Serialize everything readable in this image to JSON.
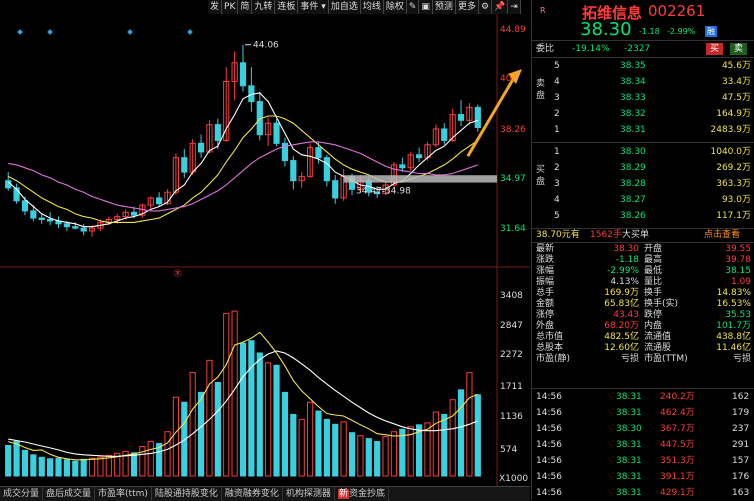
{
  "toolbar": [
    "发",
    "PK",
    "简",
    "九转",
    "连板",
    "事件",
    "加自选",
    "均线",
    "除权",
    "",
    "",
    "预测",
    "更多"
  ],
  "header": {
    "flag": "R",
    "name": "拓维信息",
    "code": "002261",
    "price": "38.30",
    "change": "-1.18",
    "change_pct": "-2.99%",
    "badge": "融"
  },
  "weibi": {
    "label": "委比",
    "pct": "-19.14%",
    "diff": "-2327",
    "buy_btn": "买",
    "sell_btn": "卖"
  },
  "sell_side_label": "卖盘",
  "buy_side_label": "买盘",
  "sell_orders": [
    {
      "level": "5",
      "price": "38.35",
      "volume": "45.6万"
    },
    {
      "level": "4",
      "price": "38.34",
      "volume": "33.4万"
    },
    {
      "level": "3",
      "price": "38.33",
      "volume": "47.5万"
    },
    {
      "level": "2",
      "price": "38.32",
      "volume": "164.9万"
    },
    {
      "level": "1",
      "price": "38.31",
      "volume": "2483.9万"
    }
  ],
  "buy_orders": [
    {
      "level": "1",
      "price": "38.30",
      "volume": "1040.0万"
    },
    {
      "level": "2",
      "price": "38.29",
      "volume": "269.2万"
    },
    {
      "level": "3",
      "price": "38.28",
      "volume": "363.3万"
    },
    {
      "level": "4",
      "price": "38.27",
      "volume": "93.0万"
    },
    {
      "level": "5",
      "price": "38.26",
      "volume": "117.1万"
    }
  ],
  "big_order": {
    "price": "38.70元有",
    "qty": "1562手",
    "type": "大买单",
    "link": "点击查看"
  },
  "stats": [
    {
      "l1": "最新",
      "v1": "38.30",
      "c1": "red",
      "l2": "开盘",
      "v2": "39.55",
      "c2": "red"
    },
    {
      "l1": "涨跌",
      "v1": "-1.18",
      "c1": "green",
      "l2": "最高",
      "v2": "39.78",
      "c2": "red"
    },
    {
      "l1": "涨幅",
      "v1": "-2.99%",
      "c1": "green",
      "l2": "最低",
      "v2": "38.15",
      "c2": "green"
    },
    {
      "l1": "振幅",
      "v1": "4.13%",
      "c1": "white",
      "l2": "量比",
      "v2": "1.09",
      "c2": "red"
    },
    {
      "l1": "总手",
      "v1": "169.9万",
      "c1": "yellow",
      "l2": "换手",
      "v2": "14.83%",
      "c2": "yellow"
    },
    {
      "l1": "金额",
      "v1": "65.83亿",
      "c1": "yellow",
      "l2": "换手(实)",
      "v2": "16.53%",
      "c2": "yellow"
    },
    {
      "l1": "涨停",
      "v1": "43.43",
      "c1": "red",
      "l2": "跌停",
      "v2": "35.53",
      "c2": "green"
    },
    {
      "l1": "外盘",
      "v1": "68.20万",
      "c1": "red",
      "l2": "内盘",
      "v2": "101.7万",
      "c2": "green"
    },
    {
      "l1": "总市值",
      "v1": "482.5亿",
      "c1": "yellow",
      "l2": "流通值",
      "v2": "438.8亿",
      "c2": "yellow"
    },
    {
      "l1": "总股本",
      "v1": "12.60亿",
      "c1": "yellow",
      "l2": "流通股",
      "v2": "11.46亿",
      "c2": "yellow"
    },
    {
      "l1": "市盈(静)",
      "v1": "亏损",
      "c1": "white",
      "l2": "市盈(TTM)",
      "v2": "亏损",
      "c2": "white"
    }
  ],
  "trades": [
    {
      "time": "14:56",
      "price": "38.31",
      "vol": "240.2万",
      "extra": "162"
    },
    {
      "time": "14:56",
      "price": "38.31",
      "vol": "462.4万",
      "extra": "179"
    },
    {
      "time": "14:56",
      "price": "38.30",
      "vol": "367.7万",
      "extra": "237"
    },
    {
      "time": "14:56",
      "price": "38.31",
      "vol": "447.5万",
      "extra": "291"
    },
    {
      "time": "14:56",
      "price": "38.31",
      "vol": "351.3万",
      "extra": "157"
    },
    {
      "time": "14:56",
      "price": "38.31",
      "vol": "391.1万",
      "extra": "176"
    },
    {
      "time": "14:56",
      "price": "38.31",
      "vol": "429.1万",
      "extra": "163"
    }
  ],
  "price_axis": [
    "44.89",
    "40.",
    "38.26",
    "34.97",
    "31.64"
  ],
  "volume_axis": [
    "3408",
    "2847",
    "2272",
    "1711",
    "1136",
    "574",
    "X1000"
  ],
  "annotations": {
    "high": "44.06",
    "support": "34.47-34.98",
    "marker": "㊍"
  },
  "bottom_tabs": [
    "成交分量",
    "盘后成交量",
    "市盈率(ttm)",
    "陆股通持股变化",
    "融资融券变化",
    "机构探测器",
    "资金抄底"
  ],
  "colors": {
    "up": "#ff3b3b",
    "down": "#39d0e0",
    "ma5": "#ffffff",
    "ma10": "#f2e34b",
    "ma20": "#e070e0",
    "arrow": "#f5a623"
  },
  "chart_data": {
    "type": "candlestick",
    "price_range": [
      29.5,
      45.5
    ],
    "volume_range": [
      0,
      3800
    ],
    "candles": [
      {
        "o": 34.6,
        "h": 35.2,
        "l": 33.9,
        "c": 34.1
      },
      {
        "o": 34.1,
        "h": 34.4,
        "l": 33.0,
        "c": 33.2
      },
      {
        "o": 33.2,
        "h": 33.5,
        "l": 32.2,
        "c": 32.5
      },
      {
        "o": 32.5,
        "h": 32.9,
        "l": 31.8,
        "c": 32.0
      },
      {
        "o": 32.0,
        "h": 32.3,
        "l": 31.6,
        "c": 31.9
      },
      {
        "o": 31.9,
        "h": 32.4,
        "l": 31.5,
        "c": 31.8
      },
      {
        "o": 31.8,
        "h": 32.1,
        "l": 31.3,
        "c": 31.6
      },
      {
        "o": 31.6,
        "h": 31.8,
        "l": 31.1,
        "c": 31.4
      },
      {
        "o": 31.4,
        "h": 31.7,
        "l": 31.2,
        "c": 31.3
      },
      {
        "o": 31.3,
        "h": 31.6,
        "l": 30.8,
        "c": 31.1
      },
      {
        "o": 31.1,
        "h": 31.5,
        "l": 30.7,
        "c": 31.3
      },
      {
        "o": 31.3,
        "h": 31.9,
        "l": 31.1,
        "c": 31.7
      },
      {
        "o": 31.7,
        "h": 32.1,
        "l": 31.5,
        "c": 31.9
      },
      {
        "o": 31.9,
        "h": 32.3,
        "l": 31.6,
        "c": 32.1
      },
      {
        "o": 32.1,
        "h": 32.6,
        "l": 31.9,
        "c": 32.4
      },
      {
        "o": 32.4,
        "h": 32.8,
        "l": 32.0,
        "c": 32.2
      },
      {
        "o": 32.2,
        "h": 33.0,
        "l": 32.0,
        "c": 32.9
      },
      {
        "o": 32.9,
        "h": 33.5,
        "l": 32.6,
        "c": 33.4
      },
      {
        "o": 33.4,
        "h": 33.8,
        "l": 32.8,
        "c": 33.0
      },
      {
        "o": 33.0,
        "h": 34.0,
        "l": 32.9,
        "c": 33.8
      },
      {
        "o": 33.8,
        "h": 36.5,
        "l": 33.6,
        "c": 36.2
      },
      {
        "o": 36.2,
        "h": 36.8,
        "l": 34.8,
        "c": 35.2
      },
      {
        "o": 35.2,
        "h": 37.5,
        "l": 35.0,
        "c": 37.2
      },
      {
        "o": 37.2,
        "h": 37.8,
        "l": 36.2,
        "c": 36.6
      },
      {
        "o": 36.6,
        "h": 38.8,
        "l": 36.5,
        "c": 38.5
      },
      {
        "o": 38.5,
        "h": 38.9,
        "l": 36.8,
        "c": 37.4
      },
      {
        "o": 37.4,
        "h": 42.5,
        "l": 37.3,
        "c": 41.5
      },
      {
        "o": 41.5,
        "h": 43.6,
        "l": 40.2,
        "c": 42.8
      },
      {
        "o": 42.8,
        "h": 44.06,
        "l": 40.8,
        "c": 41.2
      },
      {
        "o": 41.2,
        "h": 42.5,
        "l": 39.4,
        "c": 40.1
      },
      {
        "o": 40.1,
        "h": 40.8,
        "l": 37.4,
        "c": 37.8
      },
      {
        "o": 37.8,
        "h": 39.0,
        "l": 37.0,
        "c": 38.6
      },
      {
        "o": 38.6,
        "h": 38.9,
        "l": 37.0,
        "c": 37.2
      },
      {
        "o": 37.2,
        "h": 37.6,
        "l": 35.6,
        "c": 36.0
      },
      {
        "o": 36.0,
        "h": 36.3,
        "l": 34.0,
        "c": 34.6
      },
      {
        "o": 34.6,
        "h": 35.2,
        "l": 34.1,
        "c": 34.9
      },
      {
        "o": 34.9,
        "h": 37.2,
        "l": 34.8,
        "c": 36.9
      },
      {
        "o": 36.9,
        "h": 37.3,
        "l": 35.8,
        "c": 36.2
      },
      {
        "o": 36.2,
        "h": 36.4,
        "l": 34.2,
        "c": 34.6
      },
      {
        "o": 34.6,
        "h": 35.0,
        "l": 33.0,
        "c": 33.4
      },
      {
        "o": 33.4,
        "h": 35.4,
        "l": 33.2,
        "c": 34.9
      },
      {
        "o": 34.9,
        "h": 35.1,
        "l": 33.6,
        "c": 34.0
      },
      {
        "o": 34.0,
        "h": 35.0,
        "l": 33.8,
        "c": 34.6
      },
      {
        "o": 34.6,
        "h": 34.9,
        "l": 33.5,
        "c": 33.8
      },
      {
        "o": 33.8,
        "h": 34.2,
        "l": 33.4,
        "c": 33.7
      },
      {
        "o": 33.7,
        "h": 34.5,
        "l": 33.6,
        "c": 34.3
      },
      {
        "o": 34.3,
        "h": 35.9,
        "l": 34.2,
        "c": 35.7
      },
      {
        "o": 35.7,
        "h": 36.2,
        "l": 35.2,
        "c": 35.5
      },
      {
        "o": 35.5,
        "h": 36.6,
        "l": 35.3,
        "c": 36.4
      },
      {
        "o": 36.4,
        "h": 36.9,
        "l": 35.9,
        "c": 36.2
      },
      {
        "o": 36.2,
        "h": 37.3,
        "l": 36.0,
        "c": 37.1
      },
      {
        "o": 37.1,
        "h": 38.5,
        "l": 36.9,
        "c": 38.2
      },
      {
        "o": 38.2,
        "h": 38.6,
        "l": 37.1,
        "c": 37.4
      },
      {
        "o": 37.4,
        "h": 39.6,
        "l": 37.3,
        "c": 39.2
      },
      {
        "o": 39.2,
        "h": 40.2,
        "l": 38.4,
        "c": 38.8
      },
      {
        "o": 38.8,
        "h": 40.0,
        "l": 38.5,
        "c": 39.7
      },
      {
        "o": 39.7,
        "h": 39.9,
        "l": 38.0,
        "c": 38.3
      }
    ],
    "volumes": [
      620,
      700,
      520,
      430,
      380,
      350,
      360,
      330,
      300,
      340,
      360,
      380,
      420,
      460,
      500,
      470,
      600,
      700,
      660,
      900,
      1600,
      1500,
      2100,
      1700,
      2350,
      1900,
      3300,
      3350,
      2700,
      2750,
      2500,
      2300,
      2250,
      1700,
      1250,
      1150,
      1500,
      1320,
      1150,
      1050,
      1100,
      880,
      820,
      760,
      700,
      800,
      900,
      950,
      1000,
      1040,
      1080,
      1300,
      1250,
      1550,
      1750,
      2100,
      1650
    ],
    "ma5": [
      34.5,
      34.0,
      33.3,
      32.8,
      32.3,
      32.0,
      31.8,
      31.7,
      31.6,
      31.4,
      31.4,
      31.5,
      31.6,
      31.8,
      32.0,
      32.1,
      32.3,
      32.6,
      32.8,
      33.1,
      33.9,
      34.3,
      35.2,
      35.8,
      36.7,
      37.0,
      38.2,
      39.2,
      40.3,
      40.6,
      40.7,
      40.1,
      39.0,
      37.9,
      36.8,
      36.4,
      36.3,
      36.1,
      35.8,
      35.2,
      34.9,
      34.6,
      34.3,
      34.2,
      34.0,
      34.0,
      34.4,
      34.6,
      35.1,
      35.7,
      36.2,
      36.7,
      37.0,
      37.6,
      38.1,
      38.6,
      38.8
    ],
    "ma10": [
      34.9,
      34.6,
      34.2,
      33.8,
      33.4,
      33.1,
      32.8,
      32.6,
      32.3,
      32.1,
      32.0,
      31.8,
      31.7,
      31.7,
      31.7,
      31.7,
      31.8,
      31.9,
      32.0,
      32.3,
      32.6,
      32.9,
      33.4,
      33.8,
      34.4,
      35.0,
      35.9,
      36.7,
      37.6,
      38.2,
      38.9,
      39.1,
      39.1,
      38.9,
      38.6,
      38.1,
      37.6,
      37.1,
      36.6,
      36.1,
      35.7,
      35.4,
      35.2,
      35.0,
      34.7,
      34.5,
      34.5,
      34.5,
      34.7,
      34.9,
      35.1,
      35.4,
      35.7,
      36.1,
      36.6,
      37.0,
      37.4
    ],
    "ma20": [
      35.8,
      35.7,
      35.5,
      35.3,
      35.0,
      34.8,
      34.5,
      34.3,
      34.0,
      33.8,
      33.5,
      33.3,
      33.1,
      32.9,
      32.8,
      32.7,
      32.6,
      32.5,
      32.5,
      32.6,
      32.7,
      32.8,
      33.0,
      33.3,
      33.6,
      33.9,
      34.3,
      34.8,
      35.3,
      35.8,
      36.2,
      36.5,
      36.8,
      37.0,
      37.1,
      37.2,
      37.3,
      37.3,
      37.2,
      37.1,
      36.9,
      36.7,
      36.5,
      36.2,
      35.9,
      35.6,
      35.4,
      35.3,
      35.2,
      35.1,
      35.1,
      35.0,
      35.0,
      35.1,
      35.3,
      35.5,
      35.7
    ],
    "vol_ma5": [
      700,
      650,
      580,
      520,
      530,
      440,
      380,
      350,
      330,
      330,
      340,
      350,
      370,
      390,
      420,
      450,
      490,
      540,
      580,
      670,
      890,
      1070,
      1360,
      1560,
      1870,
      2010,
      2260,
      2660,
      2720,
      2800,
      2920,
      2720,
      2500,
      2240,
      1940,
      1730,
      1570,
      1410,
      1270,
      1240,
      1220,
      1130,
      1040,
      960,
      860,
      840,
      810,
      820,
      840,
      900,
      950,
      1070,
      1140,
      1220,
      1390,
      1590,
      1660
    ],
    "vol_ma10": [
      750,
      720,
      690,
      650,
      610,
      570,
      530,
      480,
      450,
      430,
      420,
      410,
      400,
      400,
      410,
      420,
      440,
      460,
      490,
      540,
      630,
      730,
      860,
      1000,
      1150,
      1320,
      1520,
      1760,
      2020,
      2210,
      2370,
      2480,
      2540,
      2500,
      2400,
      2280,
      2150,
      2000,
      1870,
      1740,
      1620,
      1500,
      1390,
      1280,
      1190,
      1120,
      1060,
      1000,
      960,
      930,
      920,
      920,
      940,
      960,
      1000,
      1050,
      1120
    ]
  }
}
